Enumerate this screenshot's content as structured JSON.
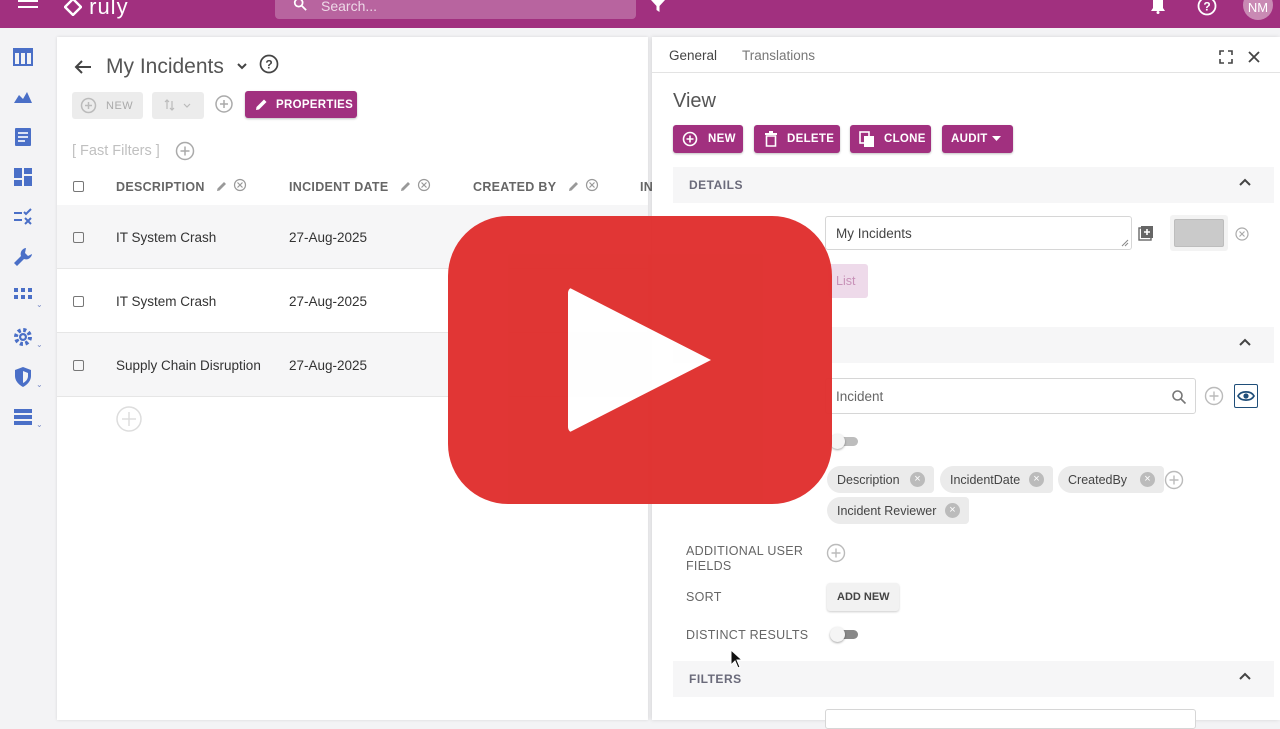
{
  "topbar": {
    "logo_text": "ruly",
    "search_placeholder": "Search...",
    "user_initials": "NM",
    "brand_color": "#a1307f"
  },
  "sidenav": {
    "items": [
      {
        "icon": "table-icon"
      },
      {
        "icon": "chart-area-icon"
      },
      {
        "icon": "document-icon"
      },
      {
        "icon": "dashboard-icon"
      },
      {
        "icon": "checklist-icon"
      },
      {
        "icon": "wrench-icon"
      },
      {
        "icon": "apps-grid-icon"
      },
      {
        "icon": "gear-icon"
      },
      {
        "icon": "shield-icon"
      },
      {
        "icon": "list-icon"
      }
    ]
  },
  "list_view": {
    "title": "My Incidents",
    "toolbar": {
      "new_label": "NEW",
      "properties_label": "PROPERTIES"
    },
    "fast_filters_label": "[ Fast Filters ]",
    "columns": [
      "DESCRIPTION",
      "INCIDENT DATE",
      "CREATED BY",
      "IN"
    ],
    "rows": [
      {
        "description": "IT System Crash",
        "incident_date": "27-Aug-2025"
      },
      {
        "description": "IT System Crash",
        "incident_date": "27-Aug-2025"
      },
      {
        "description": "Supply Chain Disruption",
        "incident_date": "27-Aug-2025"
      }
    ]
  },
  "detail": {
    "tabs": [
      "General",
      "Translations"
    ],
    "active_tab": "General",
    "view_title": "View",
    "actions": {
      "new_label": "NEW",
      "delete_label": "DELETE",
      "clone_label": "CLONE",
      "audit_label": "AUDIT"
    },
    "details_section": {
      "label": "DETAILS",
      "name_value": "My Incidents",
      "type_chip": "List"
    },
    "data_section": {
      "entity_value": "Incident",
      "fields": [
        "Description",
        "IncidentDate",
        "CreatedBy",
        "Incident Reviewer"
      ],
      "additional_user_fields_label": "ADDITIONAL USER FIELDS",
      "sort_label": "SORT",
      "add_new_label": "ADD NEW",
      "distinct_results_label": "DISTINCT RESULTS"
    },
    "filters_section": {
      "label": "FILTERS"
    }
  },
  "overlay": {
    "icon": "youtube-play-icon",
    "color": "#e0302e"
  }
}
